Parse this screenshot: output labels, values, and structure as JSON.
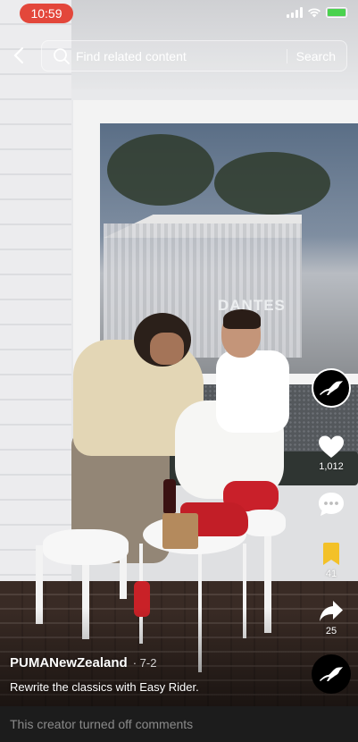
{
  "status_bar": {
    "time": "10:59"
  },
  "search": {
    "placeholder": "Find related content",
    "button_label": "Search"
  },
  "rail": {
    "likes": "1,012",
    "favorites": "41",
    "shares": "25"
  },
  "scene": {
    "window_sign": "DANTES"
  },
  "post": {
    "creator": "PUMANewZealand",
    "date": "· 7-2",
    "caption": "Rewrite the classics with Easy Rider."
  },
  "footer": {
    "comments_notice": "This creator turned off comments"
  },
  "colors": {
    "favorite_active": "#f3c128",
    "time_pill": "#e3473b"
  }
}
